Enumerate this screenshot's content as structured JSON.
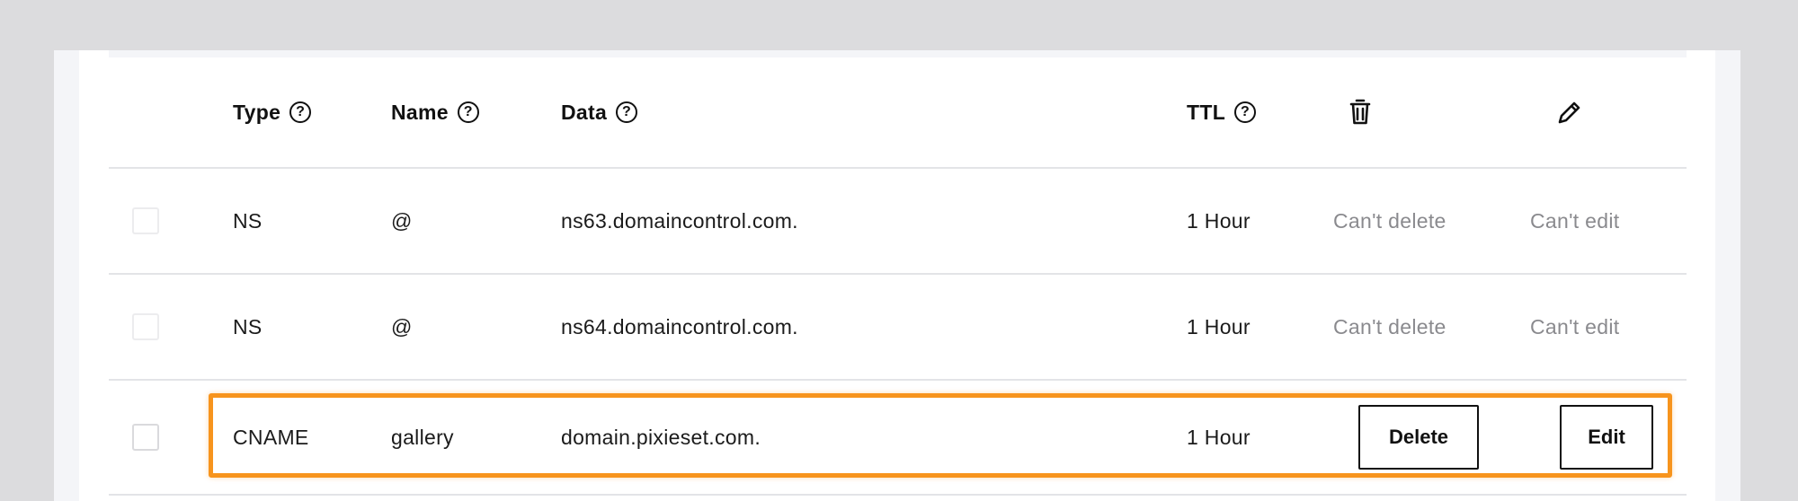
{
  "columns": {
    "type": "Type",
    "name": "Name",
    "data": "Data",
    "ttl": "TTL",
    "help_glyph": "?",
    "delete_icon": "trash-icon",
    "edit_icon": "pencil-icon"
  },
  "records": [
    {
      "type": "NS",
      "name": "@",
      "data": "ns63.domaincontrol.com.",
      "ttl": "1 Hour",
      "delete": "Can't delete",
      "edit": "Can't edit"
    },
    {
      "type": "NS",
      "name": "@",
      "data": "ns64.domaincontrol.com.",
      "ttl": "1 Hour",
      "delete": "Can't delete",
      "edit": "Can't edit"
    },
    {
      "type": "CNAME",
      "name": "gallery",
      "data": "domain.pixieset.com.",
      "ttl": "1 Hour",
      "delete": "Delete",
      "edit": "Edit"
    }
  ],
  "colors": {
    "highlight": "#f7941d",
    "muted_text": "#8a8a8e",
    "background": "#dcdcde"
  }
}
